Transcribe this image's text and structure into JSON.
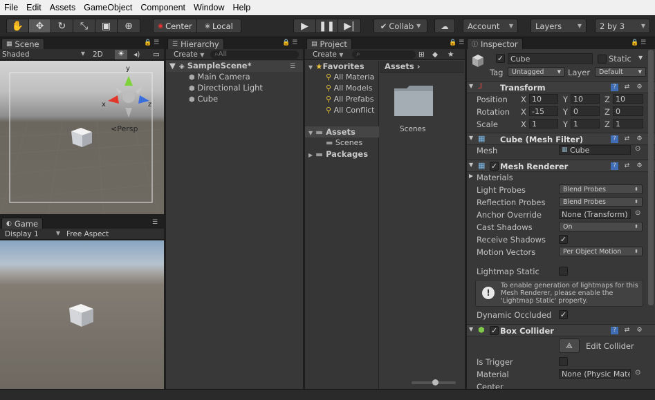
{
  "menu": [
    "File",
    "Edit",
    "Assets",
    "GameObject",
    "Component",
    "Window",
    "Help"
  ],
  "toolbar": {
    "pivot": "Center",
    "space": "Local",
    "collab": "Collab",
    "account": "Account",
    "layers": "Layers",
    "layout": "2 by 3"
  },
  "scene": {
    "tab": "Scene",
    "shading": "Shaded",
    "mode_2d": "2D",
    "persp": "<Persp",
    "gizmo_y": "y",
    "gizmo_x": "x",
    "gizmo_z": "z"
  },
  "game": {
    "tab": "Game",
    "display": "Display 1",
    "aspect": "Free Aspect"
  },
  "hierarchy": {
    "tab": "Hierarchy",
    "create": "Create",
    "search_placeholder": "All",
    "scene": "SampleScene*",
    "items": [
      "Main Camera",
      "Directional Light",
      "Cube"
    ]
  },
  "project": {
    "tab": "Project",
    "create": "Create",
    "favorites": "Favorites",
    "favorite_items": [
      "All Materia",
      "All Models",
      "All Prefabs",
      "All Conflict"
    ],
    "assets": "Assets",
    "scenes": "Scenes",
    "packages": "Packages",
    "breadcrumb": "Assets",
    "folder": "Scenes"
  },
  "inspector": {
    "tab": "Inspector",
    "name": "Cube",
    "static": "Static",
    "tag_label": "Tag",
    "tag": "Untagged",
    "layer_label": "Layer",
    "layer": "Default",
    "transform": {
      "title": "Transform",
      "position_label": "Position",
      "rotation_label": "Rotation",
      "scale_label": "Scale",
      "axis_x": "X",
      "axis_y": "Y",
      "axis_z": "Z",
      "position": [
        "10",
        "10",
        "10"
      ],
      "rotation": [
        "-15",
        "0",
        "0"
      ],
      "scale": [
        "1",
        "1",
        "1"
      ]
    },
    "mesh_filter": {
      "title": "Cube (Mesh Filter)",
      "mesh_label": "Mesh",
      "mesh": "Cube"
    },
    "mesh_renderer": {
      "title": "Mesh Renderer",
      "materials": "Materials",
      "light_probes_label": "Light Probes",
      "light_probes": "Blend Probes",
      "reflection_probes_label": "Reflection Probes",
      "reflection_probes": "Blend Probes",
      "anchor_override_label": "Anchor Override",
      "anchor_override": "None (Transform)",
      "cast_shadows_label": "Cast Shadows",
      "cast_shadows": "On",
      "receive_shadows_label": "Receive Shadows",
      "motion_vectors_label": "Motion Vectors",
      "motion_vectors": "Per Object Motion",
      "lightmap_static_label": "Lightmap Static",
      "help": "To enable generation of lightmaps for this Mesh Renderer, please enable the 'Lightmap Static' property.",
      "dynamic_occluded_label": "Dynamic Occluded"
    },
    "box_collider": {
      "title": "Box Collider",
      "edit_collider": "Edit Collider",
      "is_trigger_label": "Is Trigger",
      "material_label": "Material",
      "material": "None (Physic Mate",
      "center_label": "Center"
    }
  }
}
